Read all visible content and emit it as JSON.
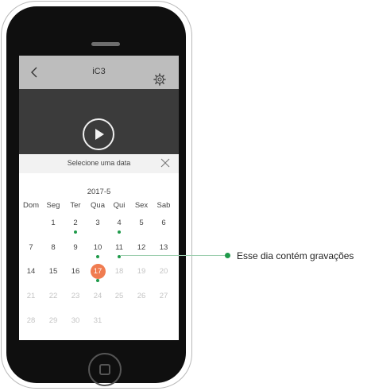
{
  "app": {
    "title": "iC3",
    "back_icon": "chevron-left-icon",
    "settings_icon": "gear-icon",
    "play_icon": "play-icon"
  },
  "date_picker": {
    "title": "Selecione uma data",
    "close_icon": "close-icon",
    "month_label": "2017-5",
    "weekdays": [
      "Dom",
      "Seg",
      "Ter",
      "Qua",
      "Qui",
      "Sex",
      "Sab"
    ],
    "selected_day": "17",
    "recording_days": [
      "2",
      "4",
      "10",
      "11",
      "17"
    ],
    "weeks": [
      [
        "",
        "1",
        "2",
        "3",
        "4",
        "5",
        "6"
      ],
      [
        "7",
        "8",
        "9",
        "10",
        "11",
        "12",
        "13"
      ],
      [
        "14",
        "15",
        "16",
        "17",
        "18",
        "19",
        "20"
      ],
      [
        "21",
        "22",
        "23",
        "24",
        "25",
        "26",
        "27"
      ],
      [
        "28",
        "29",
        "30",
        "31",
        "",
        "",
        ""
      ]
    ]
  },
  "annotation": {
    "text": "Esse dia contém gravações"
  },
  "colors": {
    "selected_day": "#f07c50",
    "recording_dot": "#1f9a4a",
    "header_bar": "#bdbdbd"
  }
}
